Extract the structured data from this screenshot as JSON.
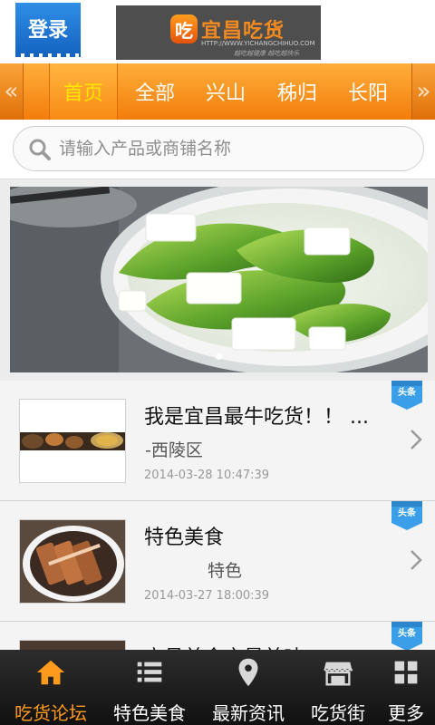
{
  "header": {
    "login_label": "登录",
    "logo_text": "宜昌吃货",
    "logo_mark": "吃",
    "logo_sub": "HTTP://WWW.YICHANGCHIHUO.COM",
    "logo_tag": "越吃越健康 越吃越快乐"
  },
  "nav": {
    "left_arrow": "«",
    "right_arrow": "»",
    "tabs": [
      {
        "label": "首页",
        "active": true
      },
      {
        "label": "全部"
      },
      {
        "label": "兴山"
      },
      {
        "label": "秭归"
      },
      {
        "label": "长阳"
      }
    ]
  },
  "search": {
    "placeholder": "请输入产品或商铺名称"
  },
  "banner": {
    "slide_count": 1,
    "active_slide": 1
  },
  "list": {
    "badge_label": "头条",
    "items": [
      {
        "title": "我是宜昌最牛吃货！！ ...",
        "subtitle": "-西陵区",
        "date": "2014-03-28 10:47:39"
      },
      {
        "title": "特色美食",
        "subtitle": "特色",
        "date": "2014-03-27 18:00:39"
      },
      {
        "title": "宜昌美食之最美味",
        "subtitle": "",
        "date": ""
      }
    ]
  },
  "tabbar": {
    "tabs": [
      {
        "label": "吃货论坛",
        "icon": "home-icon",
        "active": true
      },
      {
        "label": "特色美食",
        "icon": "list-icon"
      },
      {
        "label": "最新资讯",
        "icon": "location-pin-icon"
      },
      {
        "label": "吃货街",
        "icon": "store-icon"
      },
      {
        "label": "更多",
        "icon": "grid-icon"
      }
    ]
  },
  "colors": {
    "accent": "#f58a1f",
    "nav_active_text": "#ffe600",
    "login_blue": "#1e7bd8",
    "badge_blue": "#3a9fe8"
  }
}
